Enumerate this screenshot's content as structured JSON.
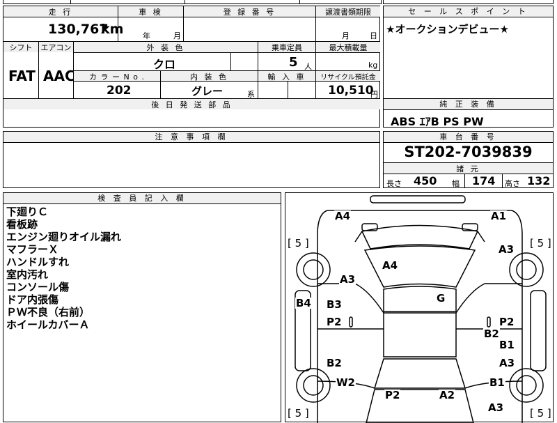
{
  "top_partial": {
    "text": "",
    "text2": ""
  },
  "car": {
    "headers": {
      "mileage": "走 行",
      "inspection": "車 検",
      "registration": "登 録 番 号",
      "transfer_doc_deadline": "譲渡書類期限",
      "shift": "シフト",
      "aircon": "エアコン",
      "exterior_color": "外 装 色",
      "capacity": "乗車定員",
      "max_load": "最大積載量",
      "color_no": "カ ラ ー N o .",
      "interior_color": "内 装 色",
      "import": "輸 入 車",
      "recycle_fee": "リサイクル預託金",
      "later_parts": "後 日 発 送 部 品",
      "notes": "注 意 事 項 欄",
      "inspector": "検 査 員 記 入 欄"
    },
    "mileage": "130,767",
    "mileage_unit": "km",
    "inspection_year_unit": "年",
    "inspection_month_unit": "月",
    "transfer_month_unit": "月",
    "transfer_day_unit": "日",
    "shift": "FAT",
    "aircon": "AAC",
    "exterior_color": "クロ",
    "capacity": "5",
    "capacity_unit": "人",
    "max_load_unit": "kg",
    "color_no": "202",
    "interior_color": "グレー",
    "interior_suffix": "系",
    "recycle_fee": "10,510",
    "recycle_unit": "円"
  },
  "sales_point": {
    "header": "セ ー ル ス ポ イ ン ト",
    "text": "★オークションデビュー★"
  },
  "equipment": {
    "header": "純 正 装 備",
    "text": "ABS  ｴｱB  PS  PW"
  },
  "chassis": {
    "header": "車 台 番 号",
    "number": "ST202-7039839"
  },
  "specs": {
    "header": "諸 元",
    "length_label": "長さ",
    "length": "450",
    "width_label": "幅",
    "width": "174",
    "height_label": "高さ",
    "height": "132"
  },
  "inspector_notes": [
    "下廻りＣ",
    "看板跡",
    "エンジン廻りオイル漏れ",
    "マフラーＸ",
    "ハンドルすれ",
    "室内汚れ",
    "コンソール傷",
    "ドア内張傷",
    "ＰＷ不良（右前）",
    "ホイールカバーＡ"
  ],
  "diagram": {
    "tires": [
      "[ 5 ]",
      "[ 5 ]",
      "[ 5 ]",
      "[ 5 ]"
    ],
    "marks": [
      "A4",
      "A1",
      "A3",
      "A4",
      "A3",
      "G",
      "B4",
      "B3",
      "P2",
      "P2",
      "B2",
      "B1",
      "B2",
      "A3",
      "W2",
      "B1",
      "P2",
      "A2",
      "A3"
    ]
  }
}
